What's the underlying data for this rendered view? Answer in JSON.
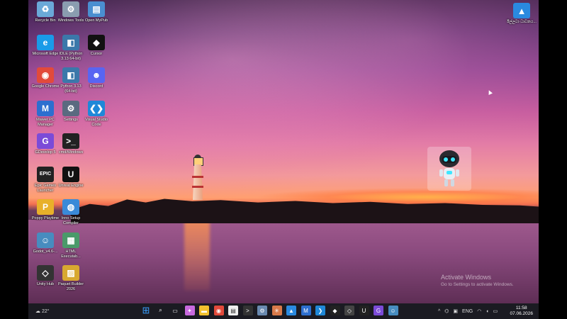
{
  "desktop_icons": [
    {
      "label": "Recycle Bin",
      "icon": "recycle-bin-icon",
      "color": "#6aa9d8"
    },
    {
      "label": "Windows Tools",
      "icon": "tools-icon",
      "color": "#8a9db0"
    },
    {
      "label": "Open MyPub",
      "icon": "mypub-icon",
      "color": "#4a8fd0"
    },
    {
      "label": "Microsoft Edge",
      "icon": "edge-icon",
      "color": "#1a9be8"
    },
    {
      "label": "IDLE (Python 3.13 64-bit)",
      "icon": "python-icon",
      "color": "#3b78aa"
    },
    {
      "label": "Cursor",
      "icon": "cursor-app-icon",
      "color": "#111111"
    },
    {
      "label": "Google Chrome",
      "icon": "chrome-icon",
      "color": "#e24a3b"
    },
    {
      "label": "Python 3.13 (64-bit)",
      "icon": "python-icon",
      "color": "#3b78aa"
    },
    {
      "label": "Discord",
      "icon": "discord-icon",
      "color": "#5865f2"
    },
    {
      "label": "Mawer PC Manager",
      "icon": "pc-manager-icon",
      "color": "#2d6fcf"
    },
    {
      "label": "Settings",
      "icon": "gear-icon",
      "color": "#5a6a80"
    },
    {
      "label": "Visual Studio Code",
      "icon": "vscode-icon",
      "color": "#1f88d8"
    },
    {
      "label": "GDevelop 5",
      "icon": "gdevelop-icon",
      "color": "#7b4bd8"
    },
    {
      "label": "cmd/Windows",
      "icon": "terminal-icon",
      "color": "#222222"
    },
    {
      "label": "Epic Games Launcher",
      "icon": "epic-icon",
      "color": "#222222"
    },
    {
      "label": "Unreal Engine",
      "icon": "unreal-icon",
      "color": "#111111"
    },
    {
      "label": "Poppy Playtime",
      "icon": "poppy-icon",
      "color": "#e8b02a"
    },
    {
      "label": "Inno Setup Compiler",
      "icon": "inno-icon",
      "color": "#3a8ad8"
    },
    {
      "label": "Godot_v4.6-...",
      "icon": "godot-icon",
      "color": "#478cbf"
    },
    {
      "label": "HTML Executab...",
      "icon": "html-exe-icon",
      "color": "#4a9a6a"
    },
    {
      "label": "Unity Hub",
      "icon": "unity-icon",
      "color": "#333333"
    },
    {
      "label": "Paquet Builder 2026",
      "icon": "paquet-icon",
      "color": "#d8a830"
    }
  ],
  "top_right_icon": {
    "label": "ඊල්ලටා ධාවනය...",
    "icon": "photos-icon",
    "color": "#2a8ae0"
  },
  "watermark": {
    "title": "Activate Windows",
    "subtitle": "Go to Settings to activate Windows."
  },
  "taskbar": {
    "weather": "22°",
    "apps": [
      {
        "icon": "windows-start-icon",
        "color": "#3aa0ff"
      },
      {
        "icon": "search-icon",
        "color": "#cccccc"
      },
      {
        "icon": "task-view-icon",
        "color": "#dddddd"
      },
      {
        "icon": "copilot-icon",
        "color": "#c86adf"
      },
      {
        "icon": "file-explorer-icon",
        "color": "#f2c12e"
      },
      {
        "icon": "chrome-icon",
        "color": "#e24a3b"
      },
      {
        "icon": "notepad-icon",
        "color": "#eeeeee"
      },
      {
        "icon": "terminal-icon",
        "color": "#333333"
      },
      {
        "icon": "settings-icon",
        "color": "#6a8ab0"
      },
      {
        "icon": "claude-icon",
        "color": "#d87a4a"
      },
      {
        "icon": "photos-icon",
        "color": "#2a8ae0"
      },
      {
        "icon": "pc-manager-icon",
        "color": "#2d6fcf"
      },
      {
        "icon": "vscode-icon",
        "color": "#1f88d8"
      },
      {
        "icon": "cursor-app-icon",
        "color": "#222222"
      },
      {
        "icon": "unity-icon",
        "color": "#444444"
      },
      {
        "icon": "unreal-icon",
        "color": "#222222"
      },
      {
        "icon": "gdevelop-icon",
        "color": "#7b4bd8"
      },
      {
        "icon": "godot-icon",
        "color": "#478cbf"
      }
    ],
    "tray_lang": "ENG",
    "time": "11:58",
    "date": "07.06.2026"
  }
}
